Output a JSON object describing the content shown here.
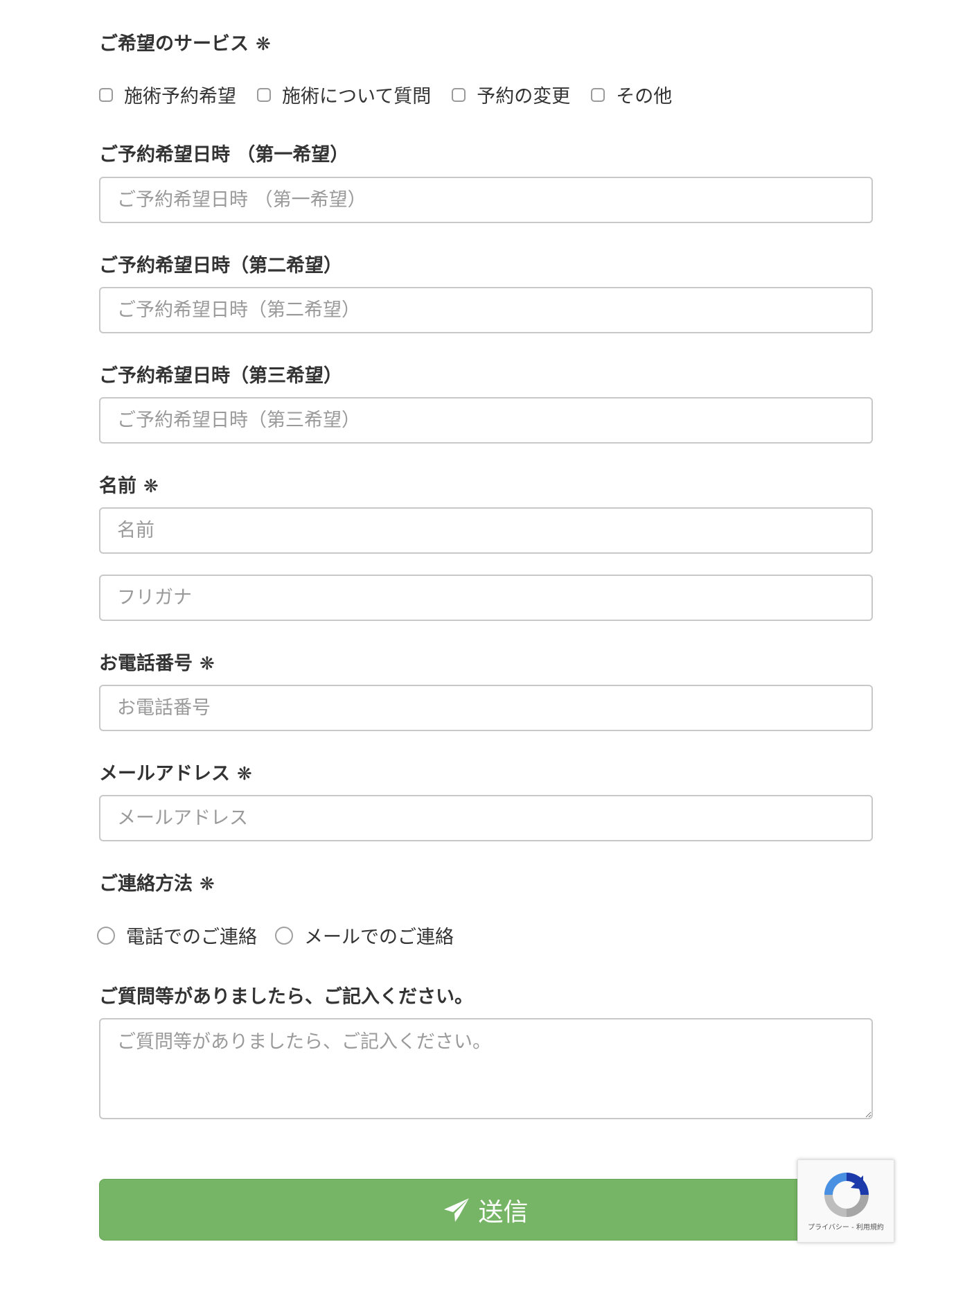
{
  "service": {
    "label": "ご希望のサービス",
    "required_mark": "❋",
    "options": [
      "施術予約希望",
      "施術について質問",
      "予約の変更",
      "その他"
    ]
  },
  "date1": {
    "label": "ご予約希望日時 （第一希望）",
    "placeholder": "ご予約希望日時 （第一希望）"
  },
  "date2": {
    "label": "ご予約希望日時（第二希望）",
    "placeholder": "ご予約希望日時（第二希望）"
  },
  "date3": {
    "label": "ご予約希望日時（第三希望）",
    "placeholder": "ご予約希望日時（第三希望）"
  },
  "name": {
    "label": "名前",
    "required_mark": "❋",
    "placeholder": "名前",
    "furigana_placeholder": "フリガナ"
  },
  "phone": {
    "label": "お電話番号",
    "required_mark": "❋",
    "placeholder": "お電話番号"
  },
  "email": {
    "label": "メールアドレス",
    "required_mark": "❋",
    "placeholder": "メールアドレス"
  },
  "contact_method": {
    "label": "ご連絡方法",
    "required_mark": "❋",
    "options": [
      "電話でのご連絡",
      "メールでのご連絡"
    ]
  },
  "question": {
    "label": "ご質問等がありましたら、ご記入ください。",
    "placeholder": "ご質問等がありましたら、ご記入ください。"
  },
  "submit": {
    "label": "送信",
    "icon": "paper-plane-icon",
    "color": "#76b565"
  },
  "recaptcha": {
    "text": "プライバシー - 利用規約",
    "icon": "recaptcha-logo-icon"
  }
}
